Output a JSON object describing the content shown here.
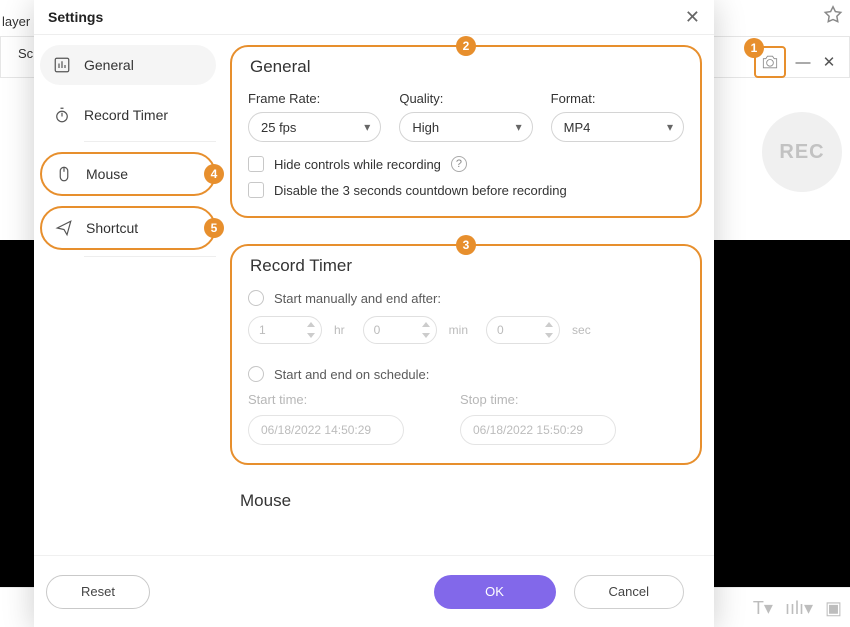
{
  "modal": {
    "title": "Settings"
  },
  "partial_bg_word": "layer",
  "bg_label_partial": "Sc",
  "rec_button_label": "REC",
  "sidebar": {
    "items": [
      {
        "label": "General"
      },
      {
        "label": "Record Timer"
      },
      {
        "label": "Mouse"
      },
      {
        "label": "Shortcut"
      }
    ]
  },
  "general": {
    "title": "General",
    "frame_rate": {
      "label": "Frame Rate:",
      "value": "25 fps"
    },
    "quality": {
      "label": "Quality:",
      "value": "High"
    },
    "format": {
      "label": "Format:",
      "value": "MP4"
    },
    "hide_controls": "Hide controls while recording",
    "disable_countdown": "Disable the 3 seconds countdown before recording"
  },
  "timer": {
    "title": "Record Timer",
    "opt_manual": "Start manually and end after:",
    "hr_value": "1",
    "hr_unit": "hr",
    "min_value": "0",
    "min_unit": "min",
    "sec_value": "0",
    "sec_unit": "sec",
    "opt_schedule": "Start and end on schedule:",
    "start_label": "Start time:",
    "stop_label": "Stop time:",
    "start_value": "06/18/2022 14:50:29",
    "stop_value": "06/18/2022 15:50:29"
  },
  "mouse_title": "Mouse",
  "buttons": {
    "reset": "Reset",
    "ok": "OK",
    "cancel": "Cancel"
  },
  "pins": {
    "one": "1",
    "two": "2",
    "three": "3",
    "four": "4",
    "five": "5"
  }
}
